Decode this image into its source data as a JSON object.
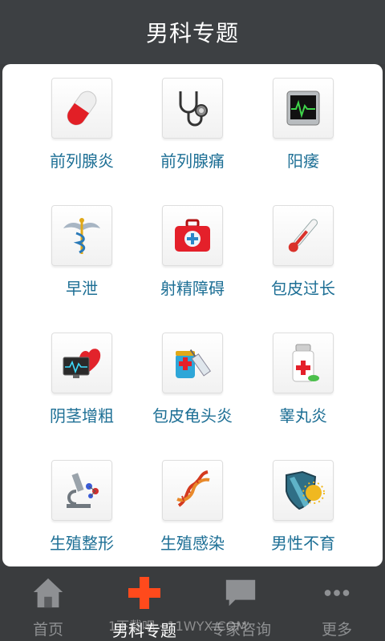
{
  "header": {
    "title": "男科专题"
  },
  "topics": [
    {
      "label": "前列腺炎",
      "icon": "capsule-icon"
    },
    {
      "label": "前列腺痛",
      "icon": "stethoscope-icon"
    },
    {
      "label": "阳痿",
      "icon": "heart-monitor-icon"
    },
    {
      "label": "早泄",
      "icon": "caduceus-icon"
    },
    {
      "label": "射精障碍",
      "icon": "first-aid-kit-icon"
    },
    {
      "label": "包皮过长",
      "icon": "thermometer-icon"
    },
    {
      "label": "阴茎增粗",
      "icon": "heart-ecg-icon"
    },
    {
      "label": "包皮龟头炎",
      "icon": "syringe-vial-icon"
    },
    {
      "label": "睾丸炎",
      "icon": "medicine-bottle-icon"
    },
    {
      "label": "生殖整形",
      "icon": "microscope-icon"
    },
    {
      "label": "生殖感染",
      "icon": "dna-icon"
    },
    {
      "label": "男性不育",
      "icon": "virus-shield-icon"
    }
  ],
  "tabbar": {
    "tabs": [
      {
        "label": "首页",
        "icon": "home-icon",
        "active": false
      },
      {
        "label": "男科专题",
        "icon": "red-cross-icon",
        "active": true
      },
      {
        "label": "专家咨询",
        "icon": "chat-bubble-icon",
        "active": false
      },
      {
        "label": "更多",
        "icon": "more-dots-icon",
        "active": false
      }
    ],
    "watermark": "1下载吧 · 11WYX.COM"
  },
  "colors": {
    "accent": "#1d6f95",
    "header_bg": "#3d4043",
    "tabbar_bg": "#3a3c3e",
    "active_tab_icon": "#ff4a1c"
  }
}
